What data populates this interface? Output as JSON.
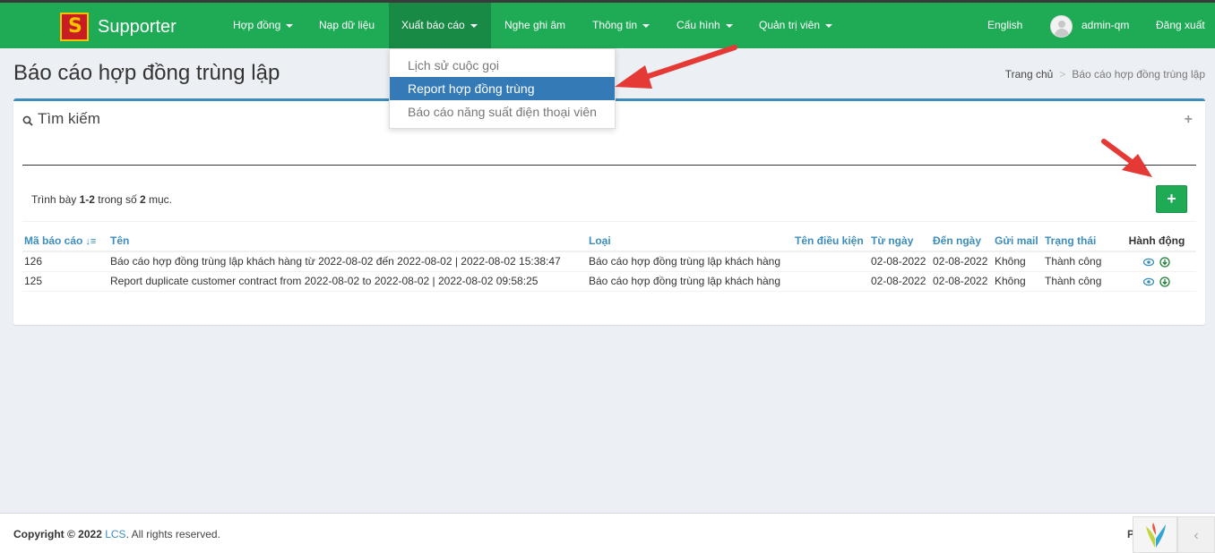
{
  "app": {
    "title": "Supporter",
    "logo_letter": "S"
  },
  "nav": {
    "items": [
      {
        "label": "Hợp đồng",
        "caret": true
      },
      {
        "label": "Nạp dữ liệu",
        "caret": false
      },
      {
        "label": "Xuất báo cáo",
        "caret": true,
        "active": true
      },
      {
        "label": "Nghe ghi âm",
        "caret": false
      },
      {
        "label": "Thông tin",
        "caret": true
      },
      {
        "label": "Cấu hình",
        "caret": true
      },
      {
        "label": "Quản trị viên",
        "caret": true
      }
    ],
    "language": "English",
    "username": "admin-qm",
    "logout": "Đăng xuất"
  },
  "dropdown": {
    "items": [
      {
        "label": "Lịch sử cuộc gọi"
      },
      {
        "label": "Report hợp đồng trùng",
        "active": true
      },
      {
        "label": "Báo cáo năng suất điện thoại viên"
      }
    ]
  },
  "page": {
    "title": "Báo cáo hợp đồng trùng lập",
    "breadcrumb": {
      "home": "Trang chủ",
      "sep": ">",
      "current": "Báo cáo hợp đồng trùng lập"
    }
  },
  "search_box": {
    "title": "Tìm kiếm",
    "expand_icon": "+"
  },
  "summary": {
    "prefix": "Trình bày",
    "range": "1-2",
    "middle": "trong số",
    "total": "2",
    "suffix": "mục."
  },
  "add_button": {
    "label": "+"
  },
  "table": {
    "columns": [
      "Mã báo cáo",
      "Tên",
      "Loại",
      "Tên điều kiện",
      "Từ ngày",
      "Đến ngày",
      "Gửi mail",
      "Trạng thái",
      "Hành động"
    ],
    "rows": [
      {
        "id": "126",
        "name": "Báo cáo hợp đồng trùng lập khách hàng từ 2022-08-02 đến 2022-08-02 | 2022-08-02 15:38:47",
        "type": "Báo cáo hợp đồng trùng lập khách hàng",
        "condition": "",
        "from": "02-08-2022",
        "to": "02-08-2022",
        "mail": "Không",
        "status": "Thành công"
      },
      {
        "id": "125",
        "name": "Report duplicate customer contract from 2022-08-02 to 2022-08-02 | 2022-08-02 09:58:25",
        "type": "Báo cáo hợp đồng trùng lập khách hàng",
        "condition": "",
        "from": "02-08-2022",
        "to": "02-08-2022",
        "mail": "Không",
        "status": "Thành công"
      }
    ]
  },
  "footer": {
    "copyright_prefix": "Copyright © 2022",
    "company": "LCS",
    "copyright_suffix": ". All rights reserved.",
    "right_text": "P"
  },
  "colors": {
    "navbar": "#1faa56",
    "navbar_active": "#188a45",
    "link": "#3c8dbc",
    "dropdown_active": "#337ab7",
    "arrow": "#e53935"
  }
}
